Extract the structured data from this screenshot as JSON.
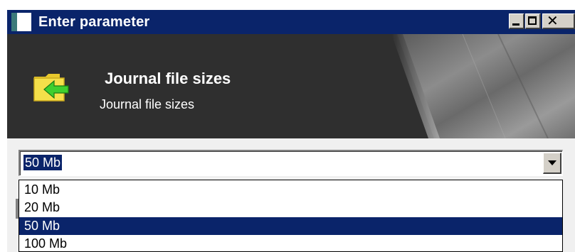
{
  "window": {
    "title": "Enter parameter",
    "caption_buttons": [
      "minimize",
      "maximize",
      "close"
    ]
  },
  "banner": {
    "icon": "folder-arrow-icon",
    "title": "Journal file sizes",
    "subtitle": "Journal file sizes"
  },
  "combo": {
    "selected_value": "50 Mb",
    "arrow_icon": "chevron-down-icon"
  },
  "dropdown": {
    "options": [
      {
        "label": "10 Mb",
        "selected": false
      },
      {
        "label": "20 Mb",
        "selected": false
      },
      {
        "label": "50 Mb",
        "selected": true
      },
      {
        "label": "100 Mb",
        "selected": false
      }
    ]
  },
  "colors": {
    "titlebar": "#0a246a",
    "banner": "#2e2e2e",
    "selection": "#0a246a",
    "folder": "#f5e04a",
    "arrow": "#3fcf2f"
  }
}
